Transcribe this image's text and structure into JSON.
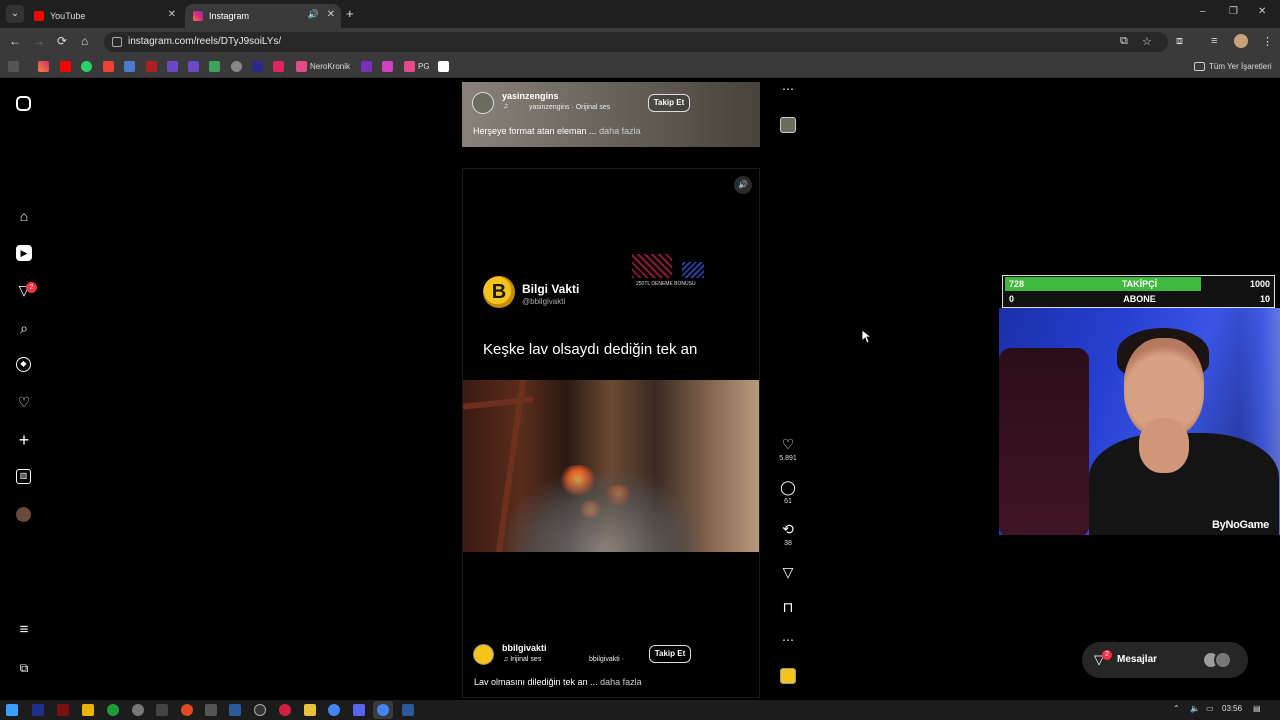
{
  "browser": {
    "tabs": [
      {
        "title": "YouTube",
        "color": "#ff0000"
      },
      {
        "title": "Instagram",
        "color": "#e1306c"
      }
    ],
    "new_tab": "+",
    "window_controls": {
      "minimize": "–",
      "restore": "❐",
      "close": "✕"
    },
    "url": "instagram.com/reels/DTyJ9soiLYs/",
    "nav": {
      "back": "←",
      "forward": "→",
      "reload": "⟳",
      "home": "⌂"
    },
    "bookmarks": {
      "items": [
        "NeroKronik",
        "PG"
      ],
      "folder": "Tüm Yer İşaretleri"
    }
  },
  "sidebar": {
    "items": [
      "instagram-icon",
      "home-icon",
      "reels-icon",
      "messages-icon",
      "search-icon",
      "explore-icon",
      "notifications-icon",
      "create-icon",
      "dashboard-icon",
      "profile-icon",
      "menu-icon",
      "also-from-meta-icon"
    ],
    "messages_badge": "2"
  },
  "reels": {
    "previous": {
      "username": "yasinzengins",
      "audio": "yasinzengins · Orijinal ses",
      "follow": "Takip Et",
      "caption": "Herşeye format atan eleman ...",
      "more": "daha fazla"
    },
    "current": {
      "channel_name": "Bilgi Vakti",
      "channel_handle": "@bbilgivakti",
      "ad_text": "250TL DENEME BONUSU",
      "headline": "Keşke lav olsaydı dediğin tek an",
      "username": "bbilgivakti",
      "audio": "♫ Irijinal ses",
      "audio_owner": "bbilgivakti ·",
      "follow": "Takip Et",
      "caption": "Lav olmasını dilediğin tek an ...",
      "more": "daha fazla"
    },
    "actions": {
      "likes": "5.891",
      "comments": "61",
      "reposts": "38"
    }
  },
  "stream_overlay": {
    "row1": {
      "left": "728",
      "label": "TAKİPÇİ",
      "right": "1000",
      "progress": 0.728
    },
    "row2": {
      "left": "0",
      "label": "ABONE",
      "right": "10",
      "progress": 0
    },
    "watermark": "ByNoGame",
    "fill_color": "#3fb83f"
  },
  "messages": {
    "label": "Mesajlar",
    "badge": "2"
  },
  "taskbar": {
    "time": "03:56"
  }
}
